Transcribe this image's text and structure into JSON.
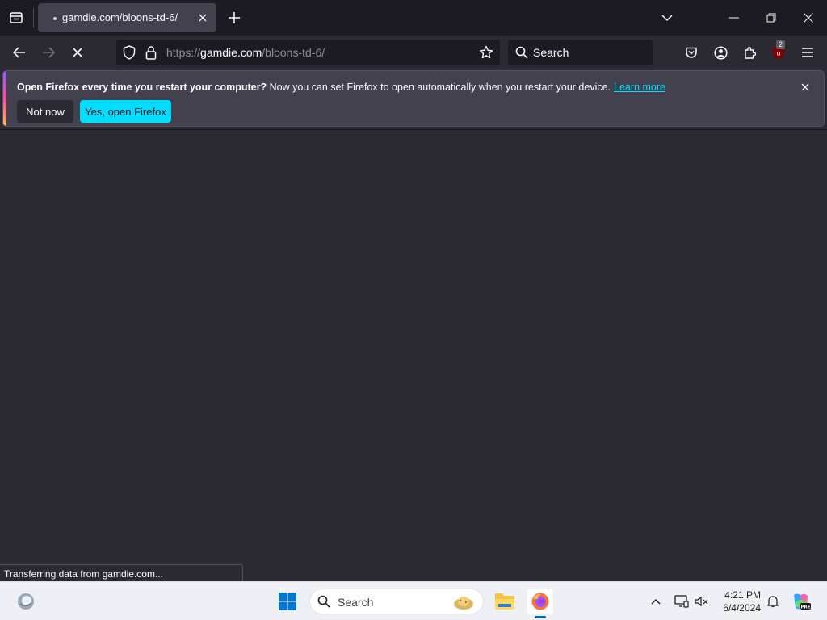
{
  "tab": {
    "title": "gamdie.com/bloons-td-6/"
  },
  "navbar": {
    "url_scheme": "https://",
    "url_host": "gamdie.com",
    "url_path": "/bloons-td-6/",
    "search_placeholder": "Search",
    "extension_badge": "2"
  },
  "notification": {
    "bold": "Open Firefox every time you restart your computer?",
    "text": " Now you can set Firefox to open automatically when you restart your device.",
    "link": "Learn more",
    "not_now": "Not now",
    "yes": "Yes, open Firefox"
  },
  "status": {
    "text": "Transferring data from gamdie.com..."
  },
  "taskbar": {
    "search_placeholder": "Search",
    "time": "4:21 PM",
    "date": "6/4/2024"
  },
  "colors": {
    "accent": "#00ddff",
    "chrome_dark": "#1c1b22",
    "toolbar": "#2b2a33",
    "notification": "#42414d"
  }
}
